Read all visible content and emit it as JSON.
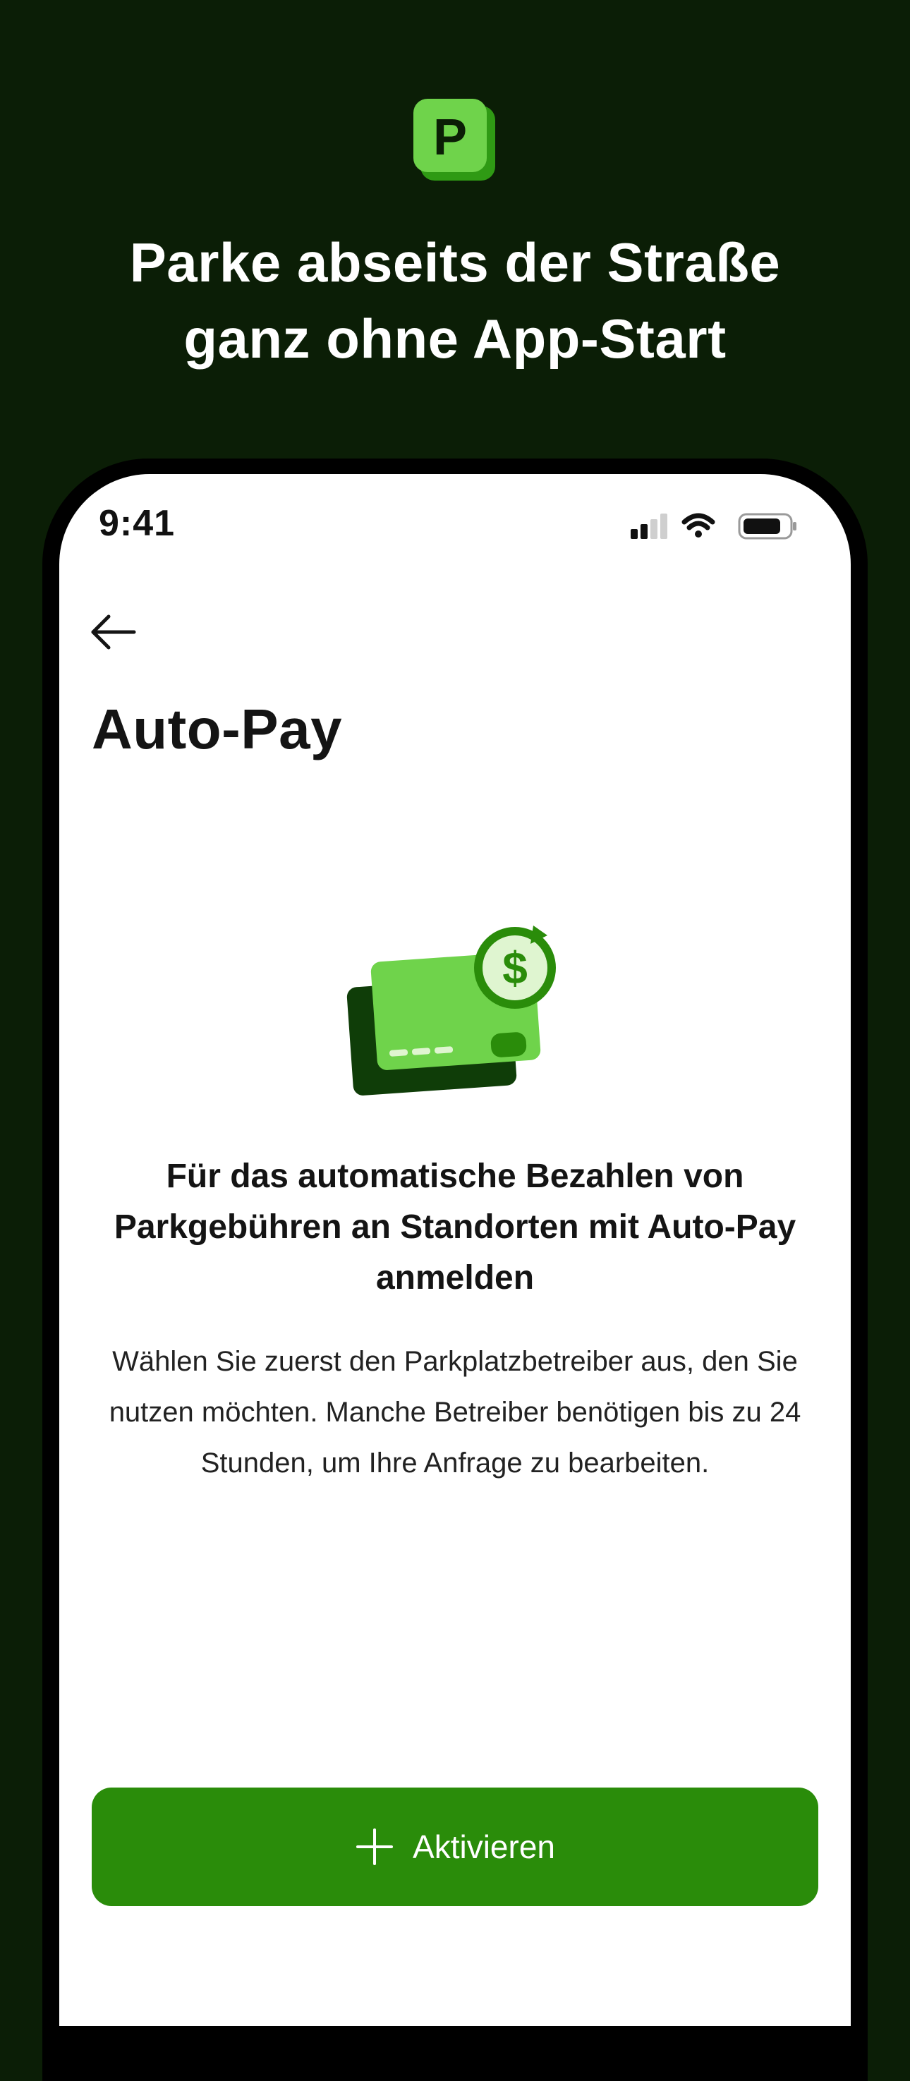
{
  "promo": {
    "headline_line1": "Parke abseits der Straße",
    "headline_line2": "ganz ohne App-Start",
    "logo_letter": "P",
    "logo_icon": "parking-p-icon"
  },
  "status_bar": {
    "time": "9:41",
    "icons": [
      "cellular-signal-icon",
      "wifi-icon",
      "battery-icon"
    ]
  },
  "nav": {
    "back_icon": "arrow-left-icon",
    "title": "Auto-Pay"
  },
  "content": {
    "illustration": "card-autopay-dollar-icon",
    "heading": "Für das automatische Bezahlen von Parkgebühren an Standorten mit Auto-Pay anmelden",
    "body": "Wählen Sie zuerst den Parkplatzbetreiber aus, den Sie nutzen möchten. Manche Betreiber benötigen bis zu 24 Stunden, um Ihre Anfrage zu bearbeiten."
  },
  "actions": {
    "activate_label": "Aktivieren",
    "activate_icon": "plus-icon"
  },
  "colors": {
    "background": "#0b1e06",
    "logo_green": "#6fd34b",
    "logo_shadow": "#2f9a14",
    "primary_button": "#2a8c0a",
    "card_dark": "#0f3d08"
  }
}
